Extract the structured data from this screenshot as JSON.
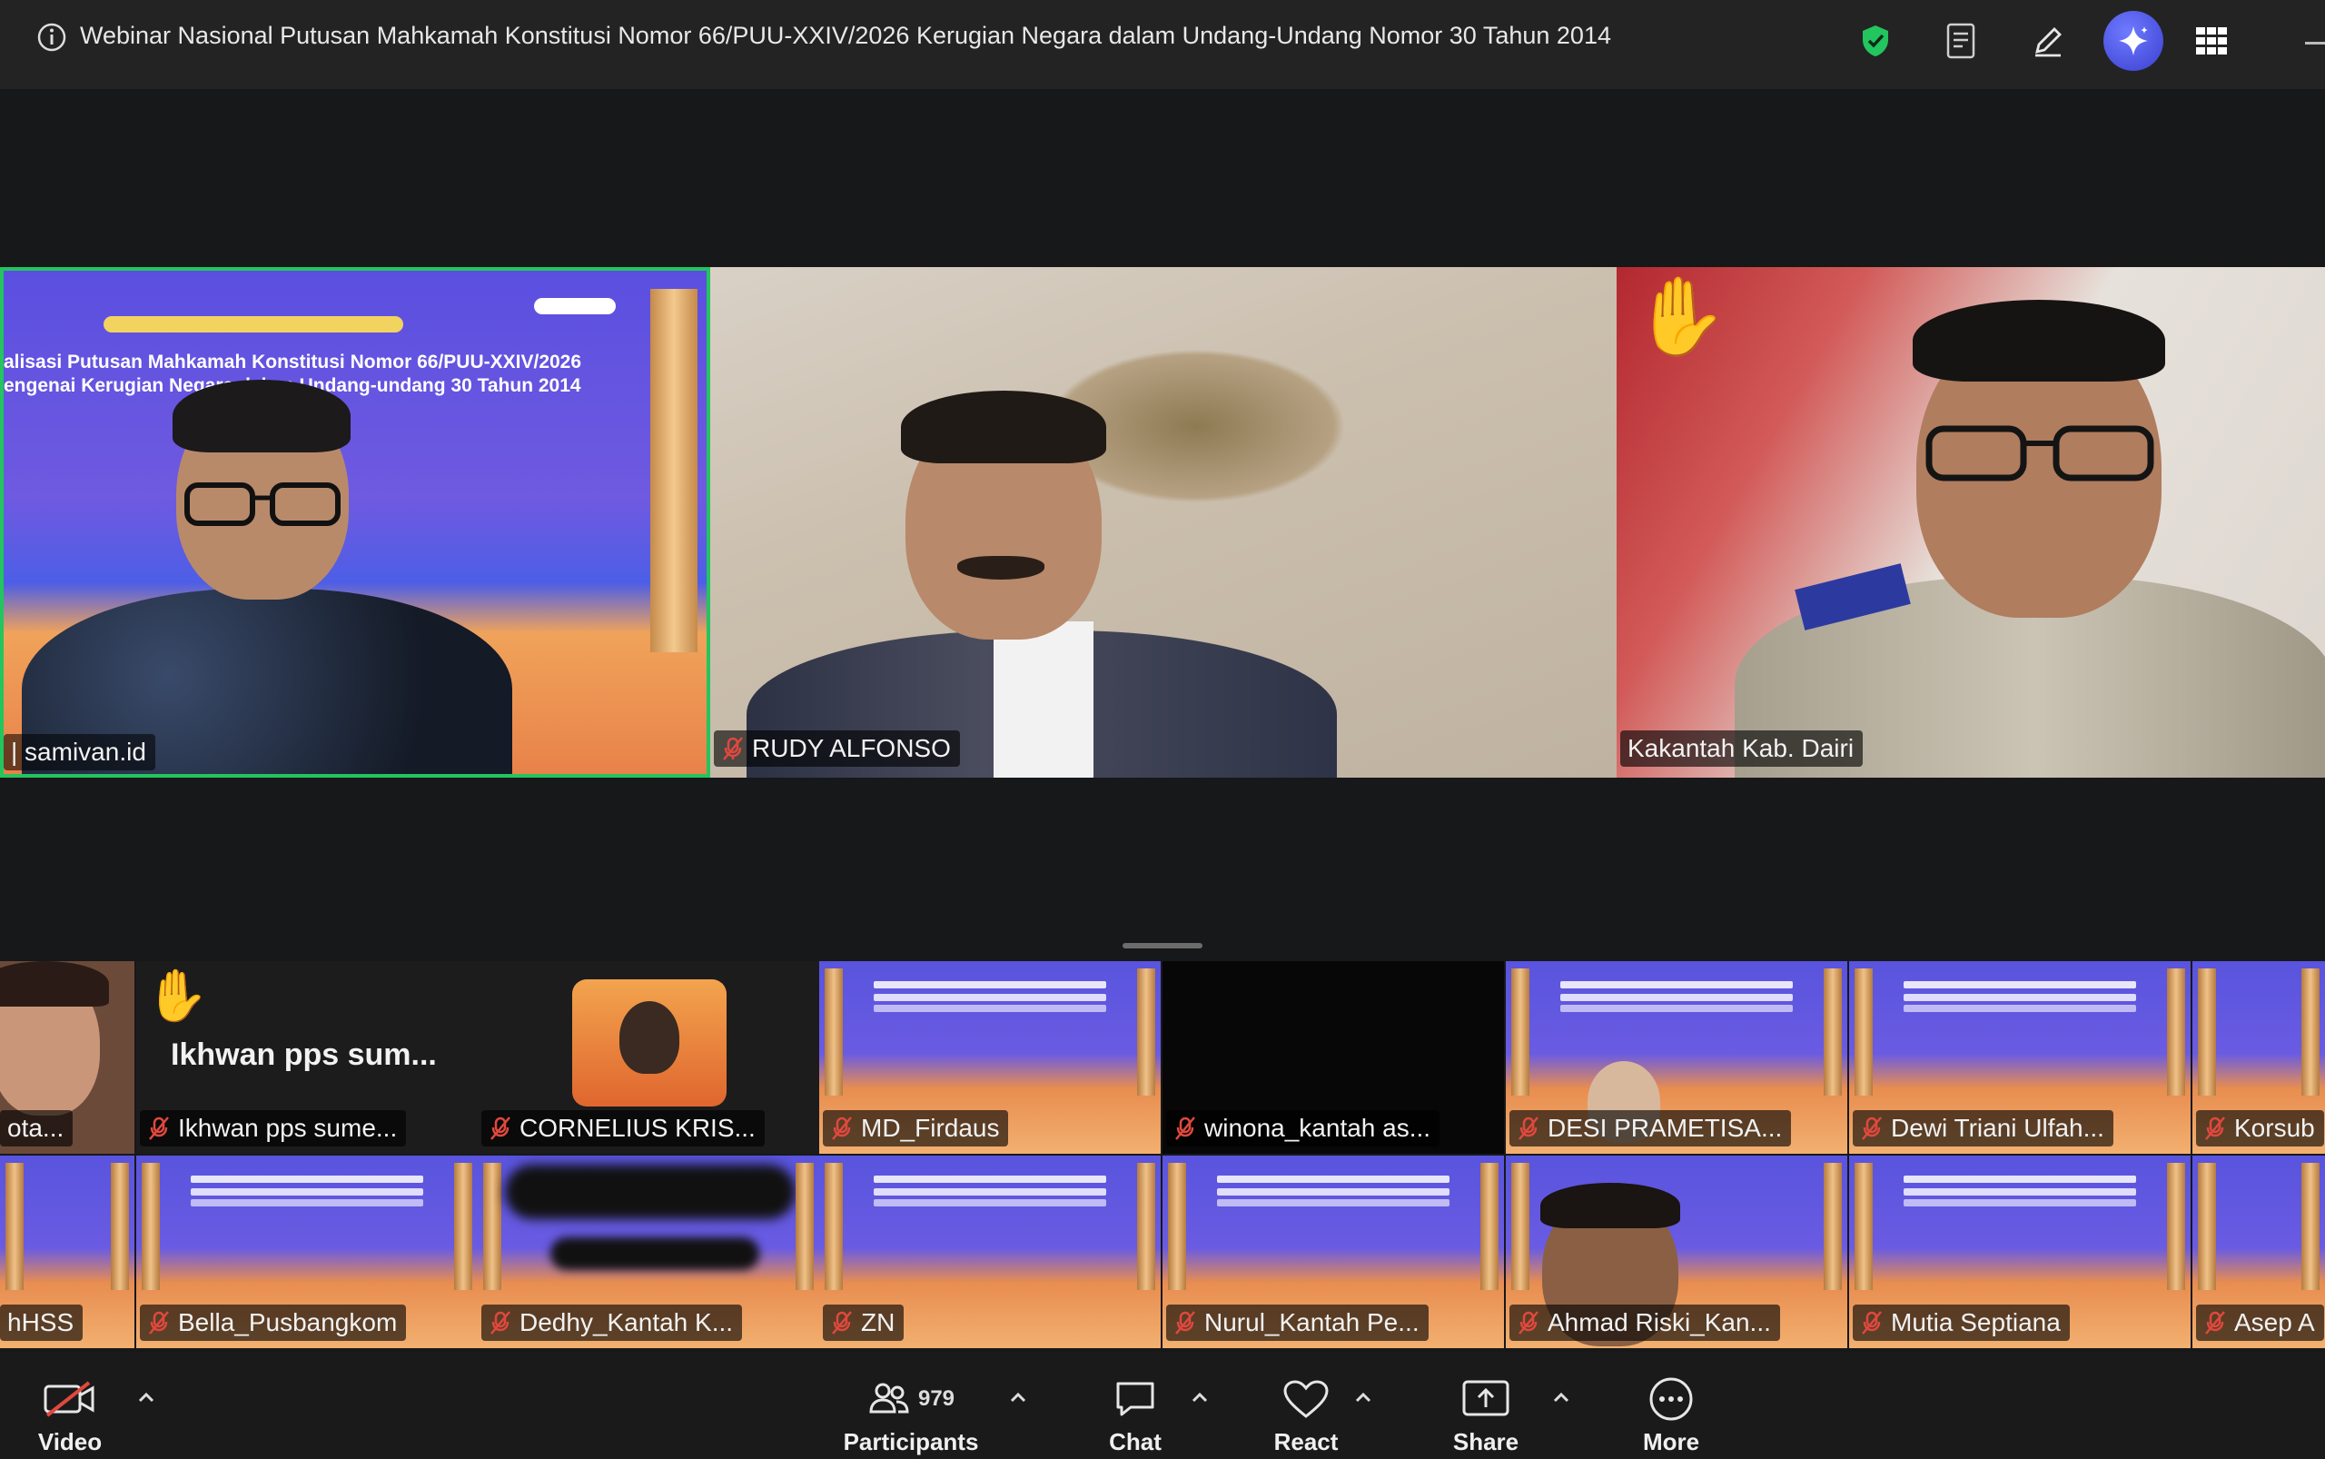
{
  "window": {
    "title": "Webinar Nasional Putusan Mahkamah Konstitusi Nomor 66/PUU-XXIV/2026 Kerugian Negara dalam Undang-Undang Nomor 30 Tahun 2014"
  },
  "title_icons": [
    "info-icon",
    "shield-check-icon",
    "notes-icon",
    "annotate-pencil-icon",
    "ai-companion-icon",
    "grid-view-icon"
  ],
  "speakers": [
    {
      "name": "| samivan.id",
      "active": true
    },
    {
      "name": "RUDY ALFONSO",
      "muted": true
    },
    {
      "name": "Kakantah Kab. Dairi",
      "hand_raised": true
    }
  ],
  "slide": {
    "line1": "alisasi Putusan Mahkamah Konstitusi Nomor 66/PUU-XXIV/2026",
    "line2": "engenai Kerugian Negara dalam Undang-undang 30 Tahun 2014"
  },
  "gallery": {
    "row1": [
      {
        "name": "ota..."
      },
      {
        "name": "Ikhwan pps sume...",
        "center_name": "Ikhwan pps sum...",
        "hand_raised": true
      },
      {
        "name": "CORNELIUS KRIS..."
      },
      {
        "name": "MD_Firdaus"
      },
      {
        "name": "winona_kantah as..."
      },
      {
        "name": "DESI PRAMETISA..."
      },
      {
        "name": "Dewi Triani Ulfah..."
      },
      {
        "name": "Korsub"
      }
    ],
    "row2": [
      {
        "name": "hHSS"
      },
      {
        "name": "Bella_Pusbangkom"
      },
      {
        "name": "Dedhy_Kantah K..."
      },
      {
        "name": "ZN"
      },
      {
        "name": "Nurul_Kantah Pe..."
      },
      {
        "name": "Ahmad Riski_Kan..."
      },
      {
        "name": "Mutia Septiana"
      },
      {
        "name": "Asep A"
      }
    ]
  },
  "toolbar": {
    "video": "Video",
    "participants": "Participants",
    "participants_count": "979",
    "chat": "Chat",
    "react": "React",
    "share": "Share",
    "more": "More"
  },
  "colors": {
    "active_speaker_border": "#23c55e",
    "mic_off": "#e0483e",
    "hand": "#f5b82e",
    "ai_button": "#4c55e6",
    "shield": "#22c55e"
  }
}
